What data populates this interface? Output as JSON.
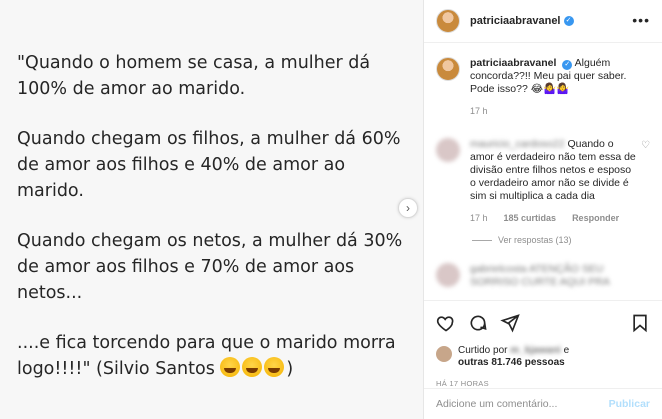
{
  "post": {
    "quote_paragraphs": [
      "\"Quando o homem se casa, a mulher dá 100% de amor ao marido.",
      "Quando chegam os filhos, a mulher dá 60% de amor aos filhos e 40% de amor ao marido.",
      "Quando chegam os netos, a mulher dá 30% de amor aos filhos e 70% de amor aos netos...",
      "....e fica torcendo para que o marido morra logo!!!!\" (Silvio Santos"
    ],
    "quote_end": ")",
    "next_arrow": "›"
  },
  "header": {
    "username": "patriciaabravanel",
    "verified_mark": "✓",
    "more": "•••"
  },
  "caption": {
    "username": "patriciaabravanel",
    "text": "Alguém concorda??!! Meu pai quer saber. Pode isso??",
    "emojis": "😂🤷‍♀️🤷‍♀️",
    "time": "17 h"
  },
  "comment1": {
    "username_blurred": "mauricio_cardoso22",
    "text": "Quando o amor é verdadeiro não tem essa de divisão entre filhos netos e esposo o verdadeiro amor não se divide é sim si multiplica a cada dia",
    "time": "17 h",
    "likes": "185 curtidas",
    "reply": "Responder",
    "view_replies": "Ver respostas (13)"
  },
  "comment2": {
    "blurred_text": "gabrielcosta ATENÇÃO SEU SORRISO CURTE AQUI PRA"
  },
  "likes": {
    "prefix": "Curtido por",
    "user_blurred": "m_kjawani",
    "and": "e",
    "others": "outras 81.746 pessoas"
  },
  "timestamp": "HÁ 17 HORAS",
  "add_comment": {
    "placeholder": "Adicione um comentário...",
    "publish": "Publicar"
  },
  "colors": {
    "verified": "#3897f0",
    "publish": "#b2dffc",
    "muted": "#8e8e8e"
  }
}
